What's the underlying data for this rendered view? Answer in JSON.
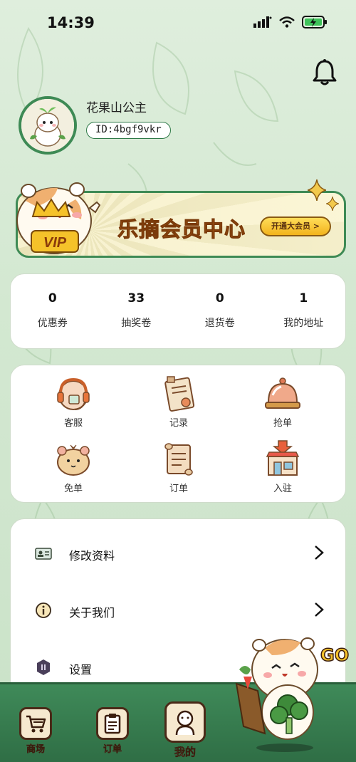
{
  "status_bar": {
    "time": "14:39"
  },
  "profile": {
    "name": "花果山公主",
    "id": "ID:4bgf9vkr"
  },
  "vip_banner": {
    "title": "乐摘会员中心",
    "button": "开通大会员 >",
    "badge_text": "VIP"
  },
  "stats": [
    {
      "value": "0",
      "label": "优惠券"
    },
    {
      "value": "33",
      "label": "抽奖卷"
    },
    {
      "value": "0",
      "label": "退货卷"
    },
    {
      "value": "1",
      "label": "我的地址"
    }
  ],
  "services": [
    {
      "label": "客服",
      "icon": "headset-icon"
    },
    {
      "label": "记录",
      "icon": "document-icon"
    },
    {
      "label": "抢单",
      "icon": "service-bell-icon"
    },
    {
      "label": "免单",
      "icon": "hamster-face-icon"
    },
    {
      "label": "订单",
      "icon": "scroll-icon"
    },
    {
      "label": "入驻",
      "icon": "storefront-icon"
    }
  ],
  "menu": [
    {
      "label": "修改资料",
      "icon": "id-card-icon"
    },
    {
      "label": "关于我们",
      "icon": "info-icon"
    },
    {
      "label": "设置",
      "icon": "settings-icon"
    }
  ],
  "bottom_nav": [
    {
      "label": "商场",
      "icon": "cart-icon"
    },
    {
      "label": "订单",
      "icon": "clipboard-icon"
    },
    {
      "label": "我的",
      "icon": "user-icon",
      "active": true
    }
  ],
  "mascot_text": "GO",
  "colors": {
    "accent_green": "#3e8a55",
    "nav_green": "#2f6e45",
    "vip_orange": "#c96b18",
    "button_yellow": "#f2b31c"
  }
}
